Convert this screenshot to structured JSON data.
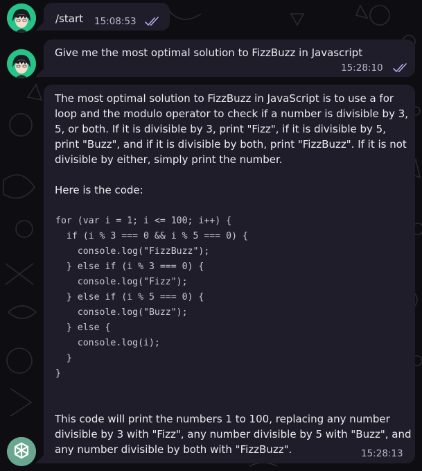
{
  "theme": {
    "background": "#0e0e12",
    "bubble": "#1f1d2a",
    "text": "#ececf1",
    "meta": "#b9b6c9",
    "read_check": "#b6a8e6",
    "user_avatar_bg": "#27c489",
    "bot_avatar_bg": "#6aa791"
  },
  "messages": [
    {
      "sender": "user",
      "text": "/start",
      "time": "15:08:53",
      "status": "double-check-icon"
    },
    {
      "sender": "user",
      "text": "Give me the most optimal solution to FizzBuzz in Javascript",
      "time": "15:28:10",
      "status": "double-check-icon"
    },
    {
      "sender": "bot",
      "intro": "The most optimal solution to FizzBuzz in JavaScript is to use a for loop and the modulo operator to check if a number is divisible by 3, 5, or both. If it is divisible by 3, print \"Fizz\", if it is divisible by 5, print \"Buzz\", and if it is divisible by both, print \"FizzBuzz\". If it is not divisible by either, simply print the number.\n\nHere is the code:",
      "code": "for (var i = 1; i <= 100; i++) {\n  if (i % 3 === 0 && i % 5 === 0) {\n    console.log(\"FizzBuzz\");\n  } else if (i % 3 === 0) {\n    console.log(\"Fizz\");\n  } else if (i % 5 === 0) {\n    console.log(\"Buzz\");\n  } else {\n    console.log(i);\n  }\n}",
      "outro": "This code will print the numbers 1 to 100, replacing any number divisible by 3 with \"Fizz\", any number divisible by 5 with \"Buzz\", and any number divisible by both with \"FizzBuzz\".",
      "time": "15:28:13"
    }
  ]
}
